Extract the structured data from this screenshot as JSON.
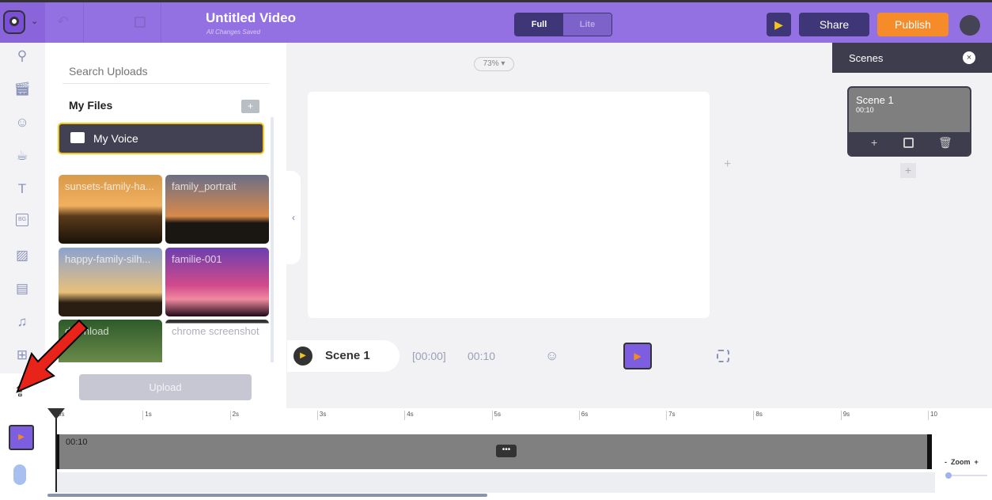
{
  "header": {
    "title": "Untitled Video",
    "save_status": "All Changes Saved",
    "modes": [
      "Full",
      "Lite"
    ],
    "active_mode": "Full",
    "share_label": "Share",
    "publish_label": "Publish",
    "accent": "#9471e3",
    "publish_color": "#f68b2a"
  },
  "sidebar": {
    "items": [
      "search",
      "library",
      "characters",
      "props",
      "text",
      "background",
      "images",
      "video",
      "music",
      "effects",
      "upload"
    ]
  },
  "uploads": {
    "search_placeholder": "Search Uploads",
    "section_title": "My Files",
    "folder": "My Voice",
    "files": [
      "sunsets-family-ha...",
      "family_portrait",
      "happy-family-silh...",
      "familie-001",
      "download",
      "chrome screenshot"
    ],
    "upload_label": "Upload"
  },
  "canvas": {
    "zoom": "73%",
    "scene_label": "Scene 1",
    "time_start": "[00:00]",
    "time_total": "00:10"
  },
  "scenes": {
    "title": "Scenes",
    "items": [
      {
        "name": "Scene 1",
        "duration": "00:10"
      }
    ]
  },
  "timeline": {
    "ticks": [
      "0s",
      "1s",
      "2s",
      "3s",
      "4s",
      "5s",
      "6s",
      "7s",
      "8s",
      "9s",
      "10"
    ],
    "clip_duration": "00:10",
    "zoom_label": "Zoom",
    "zoom_minus": "-",
    "zoom_plus": "+"
  }
}
